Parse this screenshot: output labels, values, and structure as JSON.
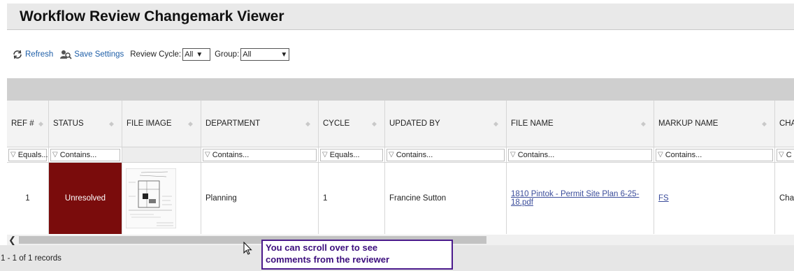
{
  "page": {
    "title": "Workflow Review Changemark Viewer"
  },
  "toolbar": {
    "refresh_label": "Refresh",
    "save_settings_label": "Save Settings",
    "review_cycle_label": "Review Cycle:",
    "review_cycle_value": "All",
    "group_label": "Group:",
    "group_value": "All"
  },
  "grid": {
    "columns": [
      {
        "label": "REF #",
        "filter": "Equals..."
      },
      {
        "label": "STATUS",
        "filter": "Contains..."
      },
      {
        "label": "FILE IMAGE",
        "filter": ""
      },
      {
        "label": "DEPARTMENT",
        "filter": "Contains..."
      },
      {
        "label": "CYCLE",
        "filter": "Equals..."
      },
      {
        "label": "UPDATED BY",
        "filter": "Contains..."
      },
      {
        "label": "FILE NAME",
        "filter": "Contains..."
      },
      {
        "label": "MARKUP NAME",
        "filter": "Contains..."
      },
      {
        "label": "CHA",
        "filter": "C"
      }
    ],
    "rows": [
      {
        "ref": "1",
        "status": "Unresolved",
        "department": "Planning",
        "cycle": "1",
        "updated_by": "Francine Sutton",
        "file_name": "1810 Pintok - Permit Site Plan 6-25-18.pdf",
        "markup_name": "FS",
        "change": "Char"
      }
    ]
  },
  "footer": {
    "records": "1 - 1 of 1 records"
  },
  "callout": {
    "text": "You can scroll over to see\ncomments from the reviewer"
  },
  "colors": {
    "status_unresolved": "#7a0c0c",
    "callout_border": "#4b1a8c",
    "link": "#3b4d9b"
  }
}
